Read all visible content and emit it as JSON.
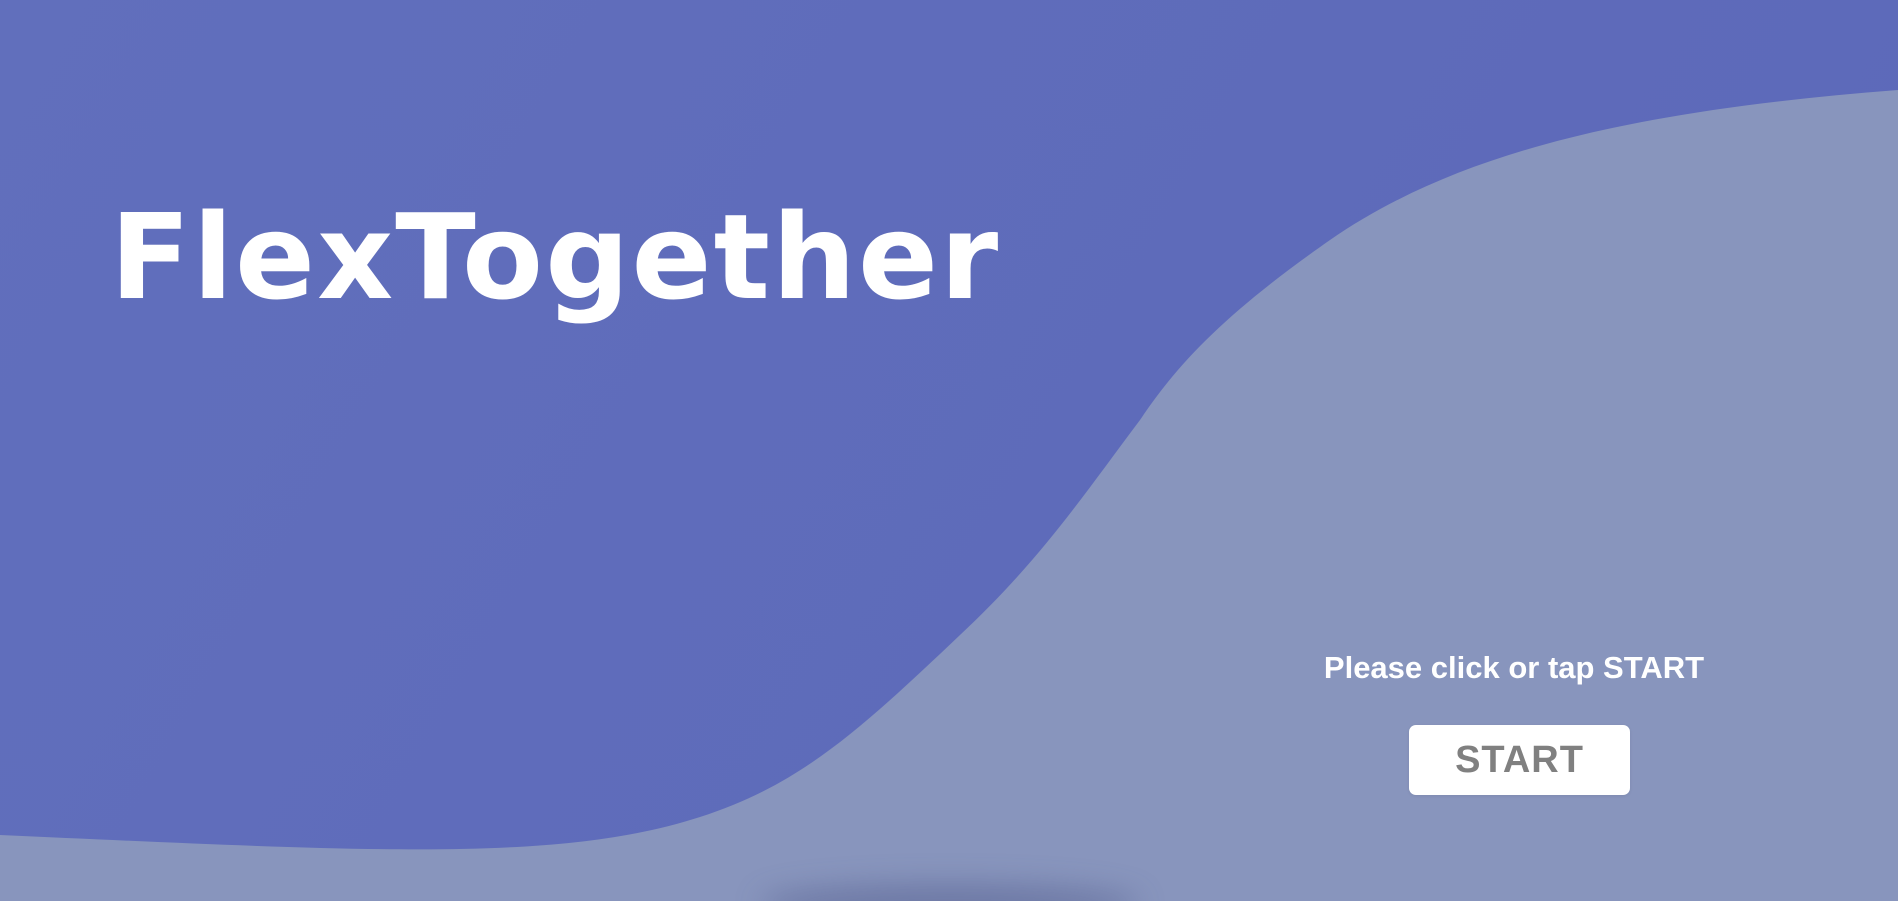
{
  "app": {
    "title": "FlexTogether"
  },
  "welcome": {
    "prompt_text": "Please click or tap START",
    "start_label": "START"
  },
  "colors": {
    "background": "#5d6bba",
    "wave": "#8895bd",
    "title_text": "#ffffff",
    "button_bg": "#ffffff",
    "button_text": "#808080"
  }
}
